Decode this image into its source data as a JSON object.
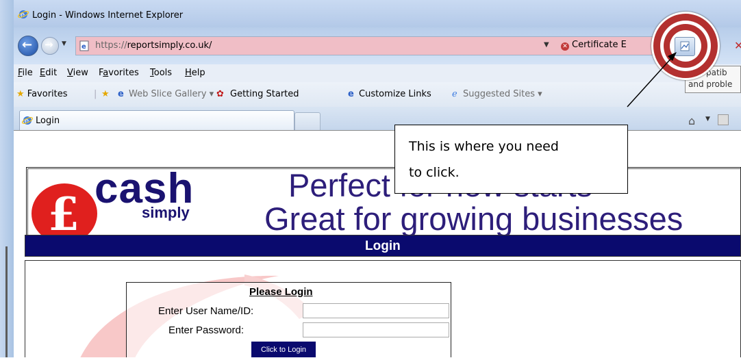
{
  "window": {
    "title": "Login - Windows Internet Explorer"
  },
  "address": {
    "url_prefix": "https://",
    "url_host": "reportsimply.co.uk/",
    "certificate": "Certificate E"
  },
  "menu": {
    "file": "F",
    "file_rest": "ile",
    "edit": "E",
    "edit_rest": "dit",
    "view": "V",
    "view_rest": "iew",
    "fav_a": "F",
    "fav_u": "a",
    "fav_rest": "vorites",
    "tools": "T",
    "tools_rest": "ools",
    "help": "H",
    "help_rest": "elp"
  },
  "favorites_bar": {
    "favorites": "Favorites",
    "web_slice": "Web Slice Gallery ▾",
    "getting_started": "Getting Started",
    "customize": "Customize Links",
    "suggested": "Suggested Sites ▾"
  },
  "tab": {
    "label": "Login"
  },
  "tooltip": {
    "line1": "patib",
    "line2": "and proble"
  },
  "callout": {
    "line1": "This is where you need",
    "line2": "to click."
  },
  "site": {
    "logo_word": "cash",
    "logo_sub": "simply",
    "tagline1": "Perfect for new starts",
    "tagline2": "Great for growing businesses",
    "login_header": "Login"
  },
  "form": {
    "title": "Please Login",
    "user_label": "Enter User Name/ID:",
    "user_value": "",
    "password_label": "Enter Password:",
    "password_value": "",
    "submit": "Click to Login"
  },
  "colors": {
    "brand_navy": "#0a0a6e",
    "logo_red": "#e0201e",
    "highlight_ring": "#b3302f"
  }
}
